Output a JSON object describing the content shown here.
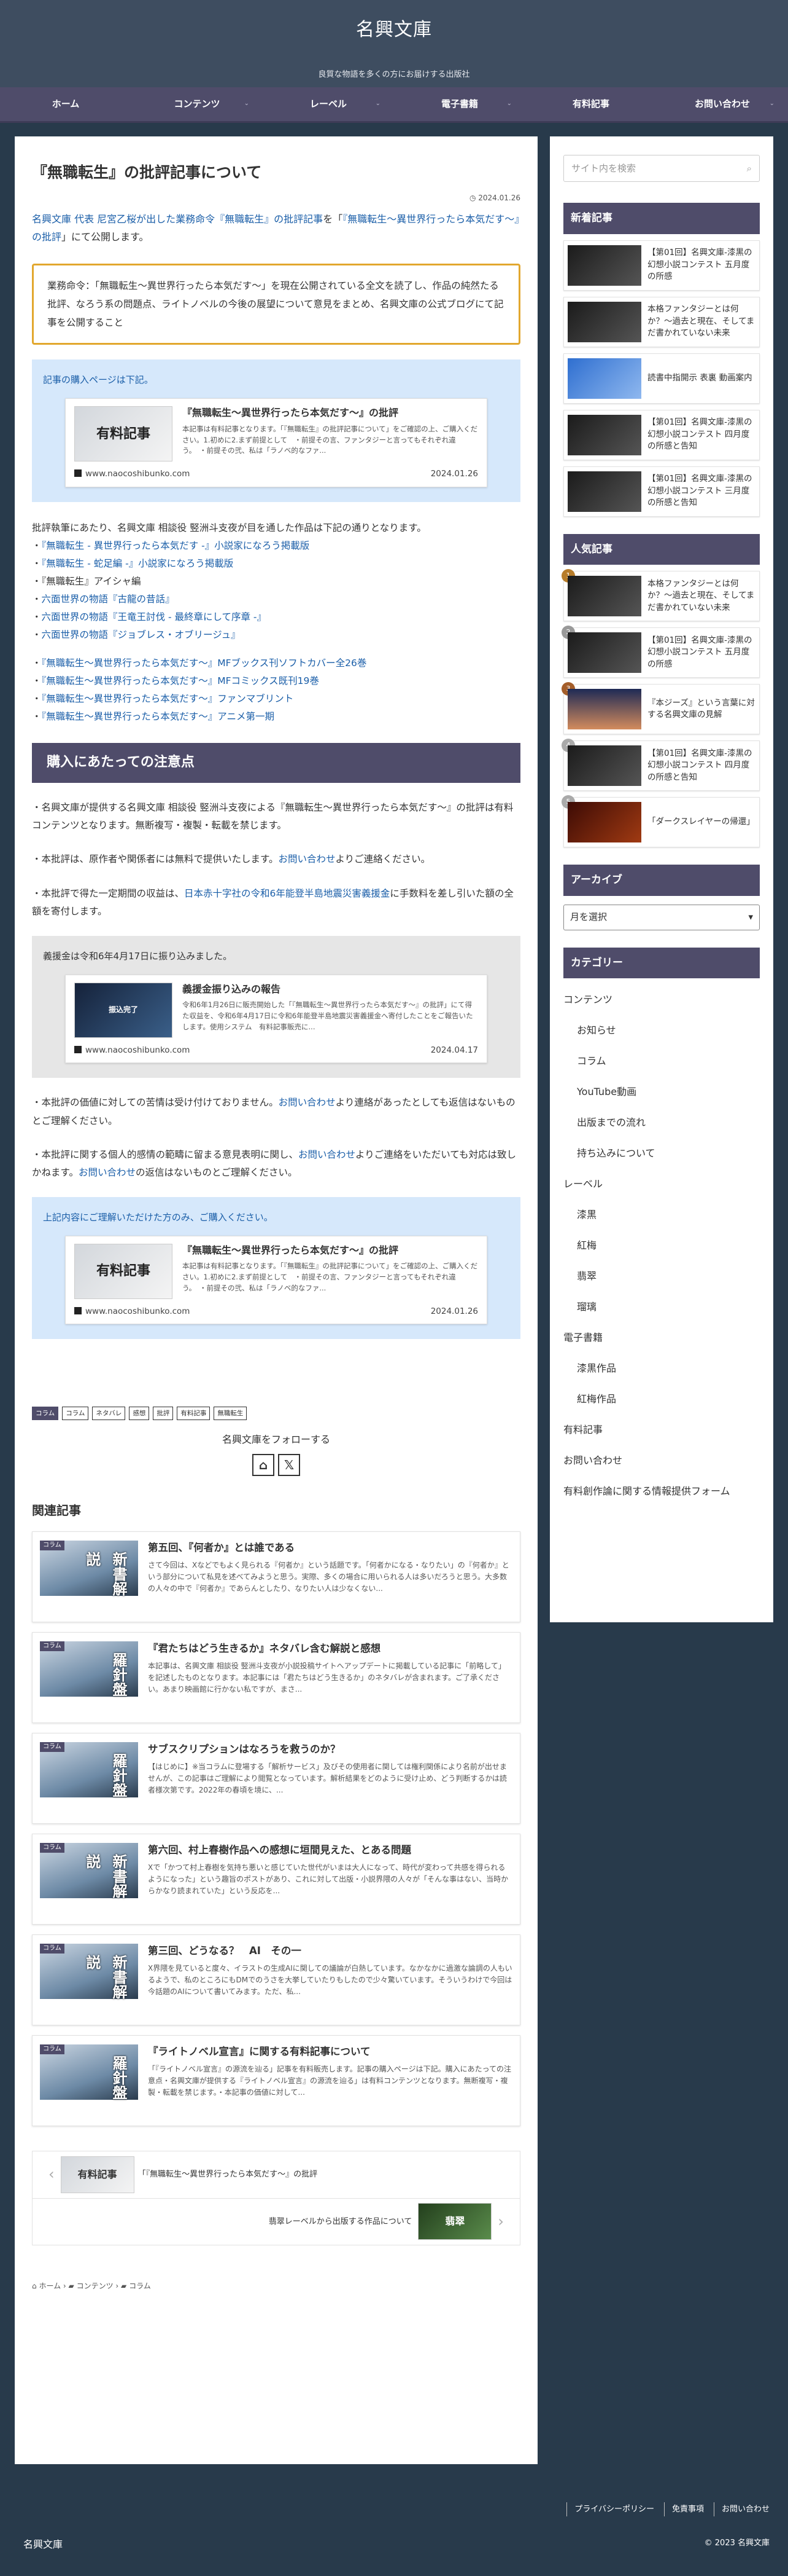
{
  "site": {
    "title": "名興文庫",
    "tagline": "良質な物語を多くの方にお届けする出版社"
  },
  "nav": [
    "ホーム",
    "コンテンツ",
    "レーベル",
    "電子書籍",
    "有料記事",
    "お問い合わせ"
  ],
  "post": {
    "title": "『無職転生』の批評記事について",
    "date": "2024.01.26",
    "lead": {
      "a1": "名興文庫 代表 尼宮乙桜が出した業務命令『無職転生』の批評記事",
      "t1": "を「",
      "a2": "『無職転生〜異世界行ったら本気だす〜』の批評",
      "t2": "」にて公開します。"
    },
    "notice": "業務命令：「無職転生〜異世界行ったら本気だす〜」を現在公開されている全文を読了し、作品の純然たる批評、なろう系の問題点、ライトノベルの今後の展望について意見をまとめ、名興文庫の公式ブログにて記事を公開すること",
    "box1_head": "記事の購入ページは下記。",
    "card": {
      "thumb": "有料記事",
      "title": "『無職転生〜異世界行ったら本気だす〜』の批評",
      "excerpt": "本記事は有料記事となります。「『無職転生』の批評記事について」をご確認の上、ご購入ください。1.初めに2.まず前提として　・前提その言、ファンタジーと言ってもそれぞれ違う。　・前提その弐、私は「ラノベ的なファ...",
      "site": "www.naocoshibunko.com",
      "date": "2024.01.26"
    },
    "list_intro": "批評執筆にあたり、名興文庫 相談役 竪洲斗支夜が目を通した作品は下記の通りとなります。",
    "list1": [
      "『無職転生 - 異世界行ったら本気だす -』小説家になろう掲載版",
      "『無職転生 - 蛇足編 -』小説家になろう掲載版",
      "『無職転生』アイシャ編",
      "六面世界の物語『古龍の昔話』",
      "六面世界の物語『王竜王討伐 - 最終章にして序章 -』",
      "六面世界の物語『ジョブレス・オブリージュ』"
    ],
    "list1_link": [
      true,
      true,
      false,
      true,
      true,
      true
    ],
    "list2": [
      "『無職転生〜異世界行ったら本気だす〜』MFブックス刊ソフトカバー全26巻",
      "『無職転生〜異世界行ったら本気だす〜』MFコミックス既刊19巻",
      "『無職転生〜異世界行ったら本気だす〜』ファンマブリント",
      "『無職転生〜異世界行ったら本気だす〜』アニメ第一期"
    ],
    "h2": "購入にあたっての注意点",
    "p1": "・名興文庫が提供する名興文庫 相談役 竪洲斗支夜による『無職転生〜異世界行ったら本気だす〜』の批評は有料コンテンツとなります。無断複写・複製・転載を禁じます。",
    "p2a": "・本批評は、原作者や関係者には無料で提供いたします。",
    "p2link": "お問い合わせ",
    "p2b": "よりご連絡ください。",
    "p3a": "・本批評で得た一定期間の収益は、",
    "p3link": "日本赤十字社の令和6年能登半島地震災害義援金",
    "p3b": "に手数料を差し引いた額の全額を寄付します。",
    "gray_head": "義援金は令和6年4月17日に振り込みました。",
    "card2": {
      "thumb": "振込完了",
      "title": "義援金振り込みの報告",
      "excerpt": "令和6年1月26日に販売開始した「『無職転生〜異世界行ったら本気だす〜』の批評」にて得た収益を、令和6年4月17日に令和6年能登半島地震災害義援金へ寄付したことをご報告いたします。使用システム　有料記事販売に...",
      "site": "www.naocoshibunko.com",
      "date": "2024.04.17"
    },
    "p4a": "・本批評の価値に対しての苦情は受け付けておりません。",
    "p4link": "お問い合わせ",
    "p4b": "より連絡があったとしても返信はないものとご理解ください。",
    "p5a": "・本批評に関する個人的感情の範疇に留まる意見表明に関し、",
    "p5link": "お問い合わせ",
    "p5b": "よりご連絡をいただいても対応は致しかねます。",
    "p5link2": "お問い合わせ",
    "p5c": "の返信はないものとご理解ください。",
    "box3_head": "上記内容にご理解いただけた方のみ、ご購入ください。",
    "tags": [
      "コラム",
      "コラム",
      "ネタバレ",
      "感想",
      "批評",
      "有料記事",
      "無職転生"
    ],
    "follow": "名興文庫をフォローする"
  },
  "related": {
    "heading": "関連記事",
    "items": [
      {
        "cat": "コラム",
        "thumb": "新書解説",
        "title": "第五回、『何者か』とは誰である",
        "ex": "さて今回は、Xなどでもよく見られる『何者か』という話題です。「何者かになる・なりたい」の『何者か』という部分について私見を述べてみようと思う。実際、多くの場合に用いられる人は多いだろうと思う。大多数の人々の中で『何者か』であらんとしたり、なりたい人は少なくない..."
      },
      {
        "cat": "コラム",
        "thumb": "羅針盤",
        "title": "『君たちはどう生きるか』ネタバレ含む解説と感想",
        "ex": "本記事は、名興文庫 相談役 竪洲斗支夜が小説投稿サイトへアップデートに掲載している記事に「前略して」を記述したものとなります。本記事には「君たちはどう生きるか」のネタバレが含まれます。ご了承ください。あまり映画館に行かない私ですが、まさ..."
      },
      {
        "cat": "コラム",
        "thumb": "羅針盤",
        "title": "サブスクリプションはなろうを救うのか？",
        "ex": "【はじめに】※当コラムに登場する「解析サービス」及びその使用者に関しては権利関係により名前が出せませんが、この記事はご理解により閲覧となっています。解析結果をどのように受け止め、どう判断するかは読者様次第です。2022年の春頃を境に、..."
      },
      {
        "cat": "コラム",
        "thumb": "新書解説",
        "title": "第六回、村上春樹作品への感想に垣間見えた、とある問題",
        "ex": "Xで「かつて村上春樹を気持ち悪いと感じていた世代がいまは大人になって、時代が変わって共感を得られるようになった」という趣旨のポストがあり、これに対して出版・小説界隈の人々が「そんな事はない、当時からかなり読まれていた」という反応を..."
      },
      {
        "cat": "コラム",
        "thumb": "新書解説",
        "title": "第三回、どうなる？　AI　その一",
        "ex": "X界隈を見ていると度々、イラストの生成AIに関しての議論が白熱しています。なかなかに過激な論調の人もいるようで、私のところにもDMでのうさを大挙していたりもしたので少々驚いています。そういうわけで今回は今話題のAIについて書いてみます。ただ、私..."
      },
      {
        "cat": "コラム",
        "thumb": "羅針盤",
        "title": "『ライトノベル宣言』に関する有料記事について",
        "ex": "「『ライトノベル宣言』の源流を辿る」記事を有料販売します。記事の購入ページは下記。購入にあたっての注意点・名興文庫が提供する『ライトノベル宣言』の源流を辿る」は有料コンテンツとなります。無断複写・複製・転載を禁じます。・本記事の価値に対して..."
      }
    ]
  },
  "pager": {
    "prev_thumb": "有料記事",
    "prev": "「『無職転生〜異世界行ったら本気だす〜』の批評",
    "next": "翡翠レーベルから出版する作品について",
    "next_thumb": "翡翠"
  },
  "breadcrumb": [
    "ホーム",
    "コンテンツ",
    "コラム"
  ],
  "sidebar": {
    "search_placeholder": "サイト内を検索",
    "new_h": "新着記事",
    "new": [
      "【第01回】名興文庫-漆黒の幻想小説コンテスト 五月度の所感",
      "本格ファンタジーとは何か？〜過去と現在、そしてまだ書かれていない未来",
      "読書中指開示 表裏 動画案内",
      "【第01回】名興文庫-漆黒の幻想小説コンテスト 四月度の所感と告知",
      "【第01回】名興文庫-漆黒の幻想小説コンテスト 三月度の所感と告知"
    ],
    "pop_h": "人気記事",
    "pop": [
      "本格ファンタジーとは何か？〜過去と現在、そしてまだ書かれていない未来",
      "【第01回】名興文庫-漆黒の幻想小説コンテスト 五月度の所感",
      "『本ジーズ』という言葉に対する名興文庫の見解",
      "【第01回】名興文庫-漆黒の幻想小説コンテスト 四月度の所感と告知",
      "「ダークスレイヤーの帰還」"
    ],
    "arch_h": "アーカイブ",
    "arch_select": "月を選択",
    "cat_h": "カテゴリー",
    "cats": [
      {
        "n": "コンテンツ",
        "s": false
      },
      {
        "n": "お知らせ",
        "s": true
      },
      {
        "n": "コラム",
        "s": true
      },
      {
        "n": "YouTube動画",
        "s": true
      },
      {
        "n": "出版までの流れ",
        "s": true
      },
      {
        "n": "持ち込みについて",
        "s": true
      },
      {
        "n": "レーベル",
        "s": false
      },
      {
        "n": "漆黒",
        "s": true
      },
      {
        "n": "紅梅",
        "s": true
      },
      {
        "n": "翡翠",
        "s": true
      },
      {
        "n": "瑠璃",
        "s": true
      },
      {
        "n": "電子書籍",
        "s": false
      },
      {
        "n": "漆黒作品",
        "s": true
      },
      {
        "n": "紅梅作品",
        "s": true
      },
      {
        "n": "有料記事",
        "s": false
      },
      {
        "n": "お問い合わせ",
        "s": false
      },
      {
        "n": "有料創作論に関する情報提供フォーム",
        "s": false
      }
    ]
  },
  "footer": {
    "links": [
      "プライバシーポリシー",
      "免責事項",
      "お問い合わせ"
    ],
    "name": "名興文庫",
    "copy": "© 2023 名興文庫"
  }
}
